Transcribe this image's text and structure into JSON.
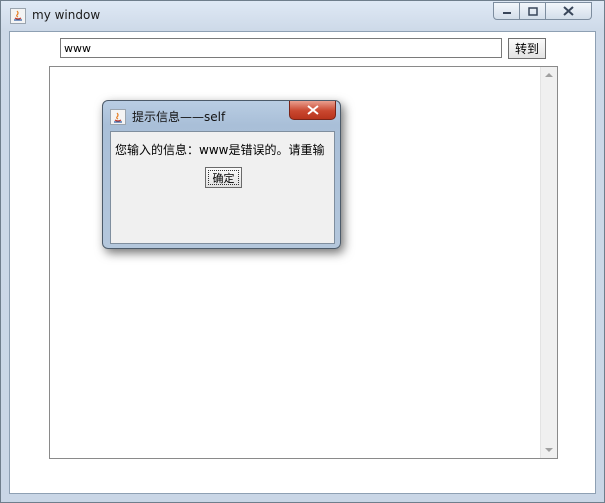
{
  "window": {
    "title": "my window",
    "url_input_value": "www",
    "go_button_label": "转到"
  },
  "dialog": {
    "title": "提示信息——self",
    "message": "您输入的信息：www是错误的。请重输",
    "ok_button_label": "确定"
  },
  "colors": {
    "close_button": "#c9472f",
    "frame": "#cdd9e8"
  }
}
